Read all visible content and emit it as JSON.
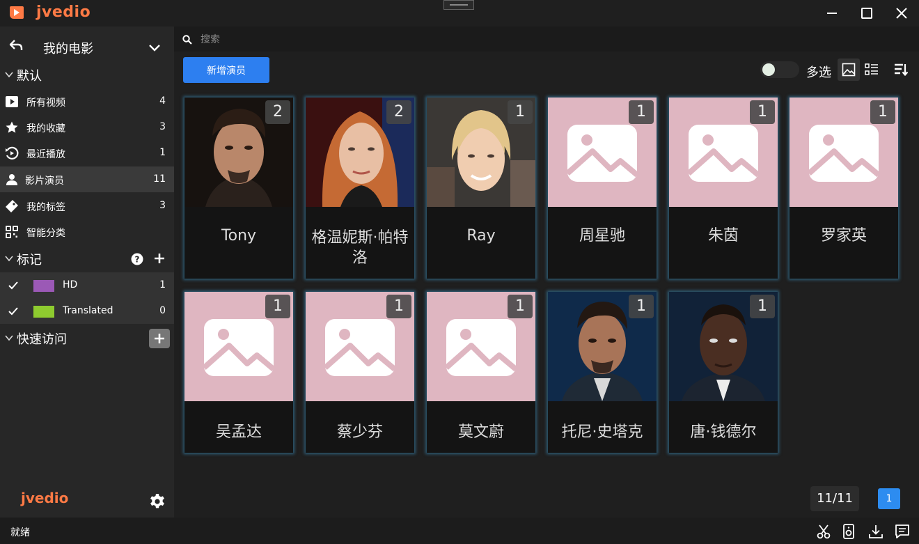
{
  "app": {
    "title": "jvedio",
    "footer_logo": "jvedio"
  },
  "sidebar": {
    "library_name": "我的电影",
    "sections": {
      "default": "默认",
      "marks": "标记",
      "quick_access": "快速访问"
    },
    "items": [
      {
        "label": "所有视频",
        "count": "4",
        "icon": "play-icon"
      },
      {
        "label": "我的收藏",
        "count": "3",
        "icon": "star-icon"
      },
      {
        "label": "最近播放",
        "count": "1",
        "icon": "history-icon"
      },
      {
        "label": "影片演员",
        "count": "11",
        "icon": "person-icon"
      },
      {
        "label": "我的标签",
        "count": "3",
        "icon": "tag-icon"
      },
      {
        "label": "智能分类",
        "count": "",
        "icon": "grid-icon"
      }
    ],
    "tags": [
      {
        "label": "HD",
        "count": "1",
        "color": "#9b59b6"
      },
      {
        "label": "Translated",
        "count": "0",
        "color": "#8ecb2f"
      }
    ]
  },
  "search": {
    "placeholder": "搜索"
  },
  "toolbar": {
    "add_actor_label": "新增演员",
    "multi_select_label": "多选"
  },
  "actors": [
    {
      "name": "Tony",
      "count": "2",
      "photo": true
    },
    {
      "name": "格温妮斯·帕特洛",
      "count": "2",
      "photo": true
    },
    {
      "name": "Ray",
      "count": "1",
      "photo": true
    },
    {
      "name": "周星驰",
      "count": "1",
      "photo": false
    },
    {
      "name": "朱茵",
      "count": "1",
      "photo": false
    },
    {
      "name": "罗家英",
      "count": "1",
      "photo": false
    },
    {
      "name": "吴孟达",
      "count": "1",
      "photo": false
    },
    {
      "name": "蔡少芬",
      "count": "1",
      "photo": false
    },
    {
      "name": "莫文蔚",
      "count": "1",
      "photo": false
    },
    {
      "name": "托尼·史塔克",
      "count": "1",
      "photo": true
    },
    {
      "name": "唐·钱德尔",
      "count": "1",
      "photo": true
    }
  ],
  "pagination": {
    "count_label": "11/11",
    "current_page": "1"
  },
  "status": {
    "text": "就绪"
  },
  "colors": {
    "accent": "#2d7ff0",
    "brand": "#ff7a45",
    "placeholder_bg": "#dfb6c1",
    "card_glow": "#3c96c8"
  }
}
